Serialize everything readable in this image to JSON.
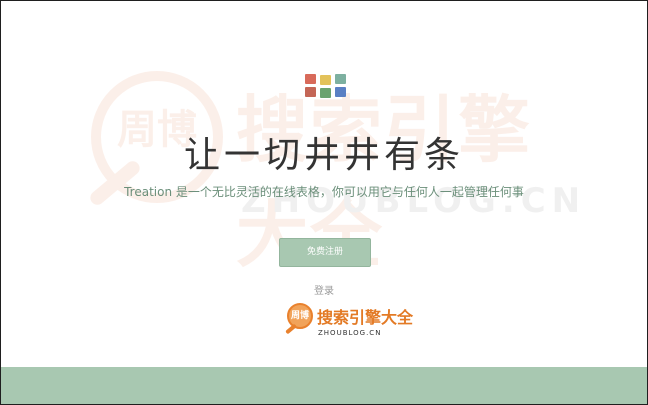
{
  "hero": {
    "headline": "让一切井井有条",
    "tagline": "Treation 是一个无比灵活的在线表格，你可以用它与任何人一起管理任何事"
  },
  "actions": {
    "register_label": "免费注册",
    "login_label": "登录"
  },
  "watermark": {
    "mark": "周博",
    "title": "搜索引擎大全",
    "subtitle": "ZHOUBLOG.CN"
  },
  "colors": {
    "accent_green": "#a8c8b1",
    "tagline_green": "#6b8f7a",
    "logo_blocks": [
      "#d86a5a",
      "#e3c25a",
      "#7db0a0",
      "#c46656",
      "#5a80c4",
      "#6aa36f"
    ]
  }
}
